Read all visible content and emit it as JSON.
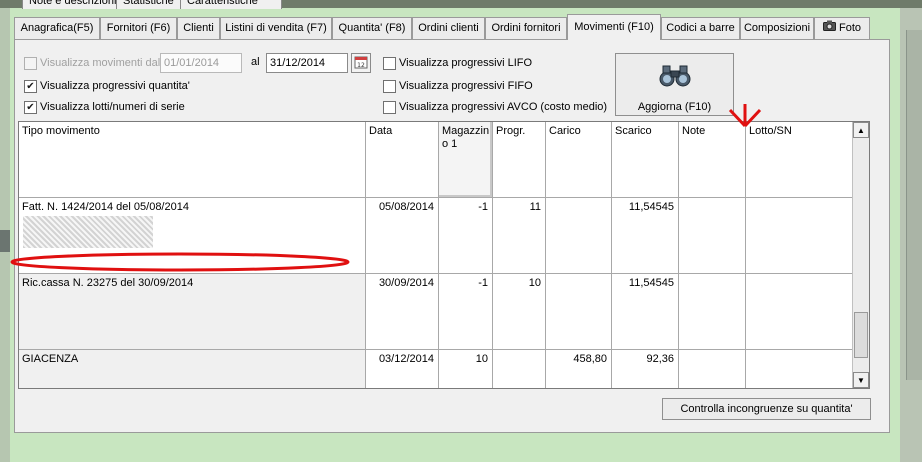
{
  "top_tabs": [
    "Note e descrizioni",
    "Statistiche",
    "Caratteristiche"
  ],
  "tabs": [
    {
      "label": "Anagrafica(F5)",
      "active": false
    },
    {
      "label": "Fornitori (F6)",
      "active": false
    },
    {
      "label": "Clienti",
      "active": false
    },
    {
      "label": "Listini di vendita (F7)",
      "active": false
    },
    {
      "label": "Quantita' (F8)",
      "active": false
    },
    {
      "label": "Ordini clienti",
      "active": false
    },
    {
      "label": "Ordini fornitori",
      "active": false
    },
    {
      "label": "Movimenti (F10)",
      "active": true
    },
    {
      "label": "Codici a barre",
      "active": false
    },
    {
      "label": "Composizioni",
      "active": false
    },
    {
      "label": "Foto",
      "active": false
    }
  ],
  "filters": {
    "movimenti_dal_label": "Visualizza movimenti dal",
    "movimenti_dal_checked": false,
    "date_from": "01/01/2014",
    "al_label": "al",
    "date_to": "31/12/2014",
    "progressivi_quantita_label": "Visualizza progressivi quantita'",
    "progressivi_quantita_checked": true,
    "lotti_label": "Visualizza lotti/numeri di serie",
    "lotti_checked": true,
    "lifo_label": "Visualizza progressivi LIFO",
    "lifo_checked": false,
    "fifo_label": "Visualizza progressivi FIFO",
    "fifo_checked": false,
    "avco_label": "Visualizza progressivi AVCO (costo medio)",
    "avco_checked": false
  },
  "refresh_button": {
    "label": "Aggiorna (F10)",
    "icon": "binoculars-icon"
  },
  "grid": {
    "headers": [
      "Tipo movimento",
      "Data",
      "Magazzin\no 1",
      "Progr.",
      "Carico",
      "Scarico",
      "Note",
      "Lotto/SN"
    ],
    "rows": [
      {
        "tipo": "Fatt. N. 1424/2014 del 05/08/2014",
        "data": "05/08/2014",
        "magazzino": "-1",
        "progr": "11",
        "carico": "",
        "scarico": "11,54545",
        "note": "",
        "lotto": ""
      },
      {
        "tipo": "Ric.cassa N. 23275 del 30/09/2014",
        "data": "30/09/2014",
        "magazzino": "-1",
        "progr": "10",
        "carico": "",
        "scarico": "11,54545",
        "note": "",
        "lotto": ""
      },
      {
        "tipo": "GIACENZA",
        "data": "03/12/2014",
        "magazzino": "10",
        "progr": "",
        "carico": "458,80",
        "scarico": "92,36",
        "note": "",
        "lotto": ""
      }
    ]
  },
  "check_button": {
    "label": "Controlla incongruenze su quantita'"
  },
  "annotation_colors": {
    "red": "#e01010"
  }
}
